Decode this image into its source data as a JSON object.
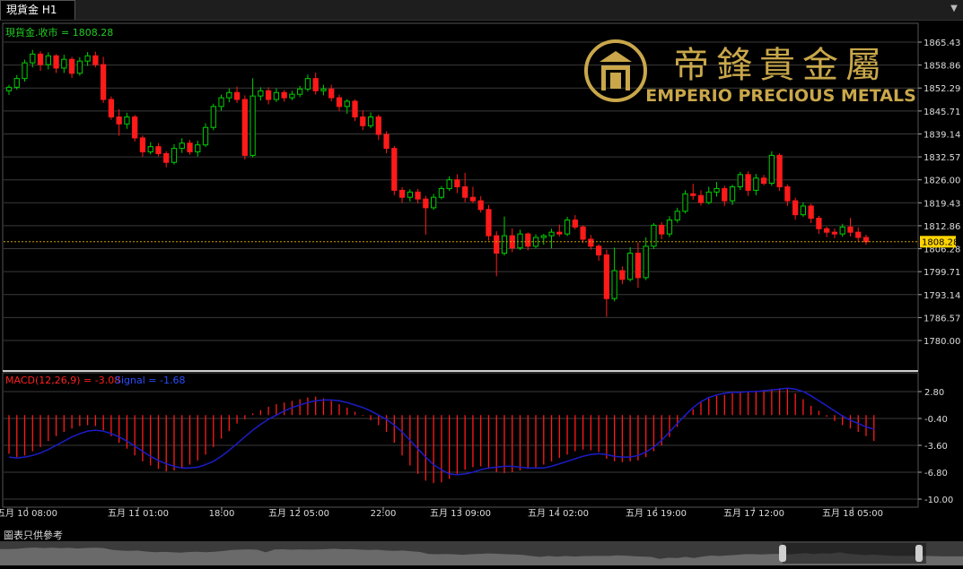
{
  "tab": {
    "title": "現貨金 H1"
  },
  "price_label": "現貨金.收市 = 1808.28",
  "current_price_tag": "1808.28",
  "logo": {
    "chinese": "帝鋒貴金屬",
    "english": "EMPERIO PRECIOUS METALS"
  },
  "macd_label": {
    "macd": "MACD(12,26,9) = -3.08",
    "signal": "Signal = -1.68"
  },
  "disclaimer": "圖表只供參考",
  "colors": {
    "up": "#00d000",
    "down": "#ff1a1a",
    "signal": "#1c1cc8",
    "grid": "#3a3a3a",
    "price_line": "#c8a200",
    "logo": "#c9a74a"
  },
  "chart_data": [
    {
      "type": "candlestick",
      "series_name": "現貨金.收市",
      "y_ticks": [
        "1865.43",
        "1858.86",
        "1852.29",
        "1845.71",
        "1839.14",
        "1832.57",
        "1826.00",
        "1819.43",
        "1812.86",
        "1806.28",
        "1799.71",
        "1793.14",
        "1786.57",
        "1780.00"
      ],
      "ylim": [
        1780.0,
        1868.0
      ],
      "x_ticks": [
        "五月 10 08:00",
        "五月 11 01:00",
        "18:00",
        "五月 12 05:00",
        "22:00",
        "五月 13 09:00",
        "五月 14 02:00",
        "五月 16 19:00",
        "五月 17 12:00",
        "五月 18 05:00"
      ],
      "last_close": 1808.28,
      "candles": [
        [
          1851.5,
          1853.2,
          1850.3,
          1852.5
        ],
        [
          1852.5,
          1856.0,
          1851.8,
          1855.0
        ],
        [
          1855.0,
          1860.4,
          1854.1,
          1859.5
        ],
        [
          1859.5,
          1863.2,
          1858.2,
          1862.0
        ],
        [
          1862.0,
          1862.8,
          1857.2,
          1859.0
        ],
        [
          1859.0,
          1862.5,
          1857.6,
          1861.5
        ],
        [
          1861.5,
          1862.0,
          1856.6,
          1858.0
        ],
        [
          1858.0,
          1861.8,
          1856.6,
          1860.5
        ],
        [
          1860.5,
          1861.2,
          1855.2,
          1856.5
        ],
        [
          1856.5,
          1861.1,
          1855.8,
          1860.0
        ],
        [
          1860.0,
          1862.6,
          1858.6,
          1861.5
        ],
        [
          1861.5,
          1862.7,
          1858.2,
          1859.0
        ],
        [
          1859.0,
          1861.2,
          1848.0,
          1849.0
        ],
        [
          1849.0,
          1849.9,
          1843.2,
          1844.0
        ],
        [
          1844.0,
          1846.2,
          1838.6,
          1842.0
        ],
        [
          1842.0,
          1845.2,
          1840.6,
          1844.0
        ],
        [
          1844.0,
          1844.6,
          1837.0,
          1838.0
        ],
        [
          1838.0,
          1838.7,
          1832.6,
          1834.0
        ],
        [
          1834.0,
          1836.8,
          1833.3,
          1835.5
        ],
        [
          1835.5,
          1836.5,
          1832.7,
          1833.5
        ],
        [
          1833.5,
          1834.2,
          1829.6,
          1831.0
        ],
        [
          1831.0,
          1836.2,
          1830.4,
          1835.0
        ],
        [
          1835.0,
          1837.9,
          1833.7,
          1836.5
        ],
        [
          1836.5,
          1837.4,
          1833.2,
          1834.0
        ],
        [
          1834.0,
          1837.2,
          1832.7,
          1836.0
        ],
        [
          1836.0,
          1842.2,
          1835.4,
          1841.0
        ],
        [
          1841.0,
          1847.8,
          1840.2,
          1847.0
        ],
        [
          1847.0,
          1850.4,
          1845.8,
          1849.5
        ],
        [
          1849.5,
          1852.2,
          1848.2,
          1851.0
        ],
        [
          1851.0,
          1852.7,
          1848.0,
          1849.0
        ],
        [
          1849.0,
          1850.2,
          1831.8,
          1833.0
        ],
        [
          1833.0,
          1855.1,
          1832.4,
          1850.0
        ],
        [
          1850.0,
          1852.5,
          1848.7,
          1851.5
        ],
        [
          1851.5,
          1852.5,
          1847.6,
          1849.0
        ],
        [
          1849.0,
          1852.2,
          1848.3,
          1851.0
        ],
        [
          1851.0,
          1851.7,
          1848.4,
          1849.5
        ],
        [
          1849.5,
          1851.5,
          1848.8,
          1850.5
        ],
        [
          1850.5,
          1852.9,
          1849.7,
          1852.0
        ],
        [
          1852.0,
          1856.1,
          1851.3,
          1855.0
        ],
        [
          1855.0,
          1856.7,
          1850.4,
          1851.5
        ],
        [
          1851.5,
          1853.2,
          1850.2,
          1852.0
        ],
        [
          1852.0,
          1853.2,
          1848.5,
          1849.5
        ],
        [
          1849.5,
          1850.4,
          1845.6,
          1847.0
        ],
        [
          1847.0,
          1849.1,
          1844.9,
          1848.5
        ],
        [
          1848.5,
          1849.0,
          1842.8,
          1844.0
        ],
        [
          1844.0,
          1845.9,
          1840.2,
          1841.5
        ],
        [
          1841.5,
          1845.3,
          1840.8,
          1844.0
        ],
        [
          1844.0,
          1844.7,
          1837.4,
          1839.0
        ],
        [
          1839.0,
          1839.9,
          1833.6,
          1835.0
        ],
        [
          1835.0,
          1835.7,
          1821.6,
          1823.0
        ],
        [
          1823.0,
          1823.9,
          1819.4,
          1821.0
        ],
        [
          1821.0,
          1823.3,
          1819.8,
          1822.5
        ],
        [
          1822.5,
          1823.4,
          1819.2,
          1820.5
        ],
        [
          1820.5,
          1821.4,
          1810.3,
          1818.0
        ],
        [
          1818.0,
          1822.0,
          1817.4,
          1821.0
        ],
        [
          1821.0,
          1824.2,
          1820.4,
          1823.5
        ],
        [
          1823.5,
          1827.0,
          1822.8,
          1826.0
        ],
        [
          1826.0,
          1827.6,
          1822.2,
          1824.0
        ],
        [
          1824.0,
          1828.0,
          1819.6,
          1821.0
        ],
        [
          1821.0,
          1824.0,
          1819.3,
          1820.0
        ],
        [
          1820.0,
          1821.3,
          1816.6,
          1817.5
        ],
        [
          1817.5,
          1818.8,
          1808.6,
          1810.0
        ],
        [
          1810.0,
          1811.3,
          1798.4,
          1805.0
        ],
        [
          1805.0,
          1815.5,
          1804.3,
          1810.0
        ],
        [
          1810.0,
          1812.1,
          1805.3,
          1806.5
        ],
        [
          1806.5,
          1811.7,
          1805.9,
          1810.5
        ],
        [
          1810.5,
          1810.9,
          1805.8,
          1807.0
        ],
        [
          1807.0,
          1810.4,
          1806.4,
          1809.5
        ],
        [
          1809.5,
          1810.5,
          1807.4,
          1810.0
        ],
        [
          1810.0,
          1812.0,
          1806.4,
          1811.0
        ],
        [
          1811.0,
          1813.2,
          1809.8,
          1810.5
        ],
        [
          1810.5,
          1815.4,
          1809.9,
          1814.5
        ],
        [
          1814.5,
          1815.9,
          1811.8,
          1812.5
        ],
        [
          1812.5,
          1813.0,
          1807.9,
          1809.0
        ],
        [
          1809.0,
          1810.2,
          1806.0,
          1807.0
        ],
        [
          1807.0,
          1807.6,
          1802.8,
          1804.5
        ],
        [
          1804.5,
          1806.0,
          1786.8,
          1792.0
        ],
        [
          1792.0,
          1806.6,
          1791.2,
          1800.0
        ],
        [
          1800.0,
          1801.2,
          1796.1,
          1797.5
        ],
        [
          1797.5,
          1806.7,
          1796.9,
          1805.0
        ],
        [
          1805.0,
          1808.1,
          1795.1,
          1798.0
        ],
        [
          1798.0,
          1809.5,
          1797.3,
          1807.0
        ],
        [
          1807.0,
          1813.6,
          1806.2,
          1813.0
        ],
        [
          1813.0,
          1813.9,
          1809.0,
          1810.5
        ],
        [
          1810.5,
          1815.6,
          1809.6,
          1814.5
        ],
        [
          1814.5,
          1818.0,
          1813.7,
          1817.0
        ],
        [
          1817.0,
          1823.0,
          1816.4,
          1822.0
        ],
        [
          1822.0,
          1824.9,
          1820.3,
          1821.5
        ],
        [
          1821.5,
          1823.0,
          1818.6,
          1819.5
        ],
        [
          1819.5,
          1824.0,
          1819.0,
          1822.5
        ],
        [
          1822.5,
          1825.4,
          1821.2,
          1823.5
        ],
        [
          1823.5,
          1824.3,
          1818.5,
          1820.0
        ],
        [
          1820.0,
          1824.6,
          1818.8,
          1824.0
        ],
        [
          1824.0,
          1828.3,
          1823.1,
          1827.5
        ],
        [
          1827.5,
          1828.4,
          1821.4,
          1823.0
        ],
        [
          1823.0,
          1827.7,
          1821.6,
          1826.5
        ],
        [
          1826.5,
          1827.4,
          1824.4,
          1825.0
        ],
        [
          1825.0,
          1834.2,
          1824.3,
          1833.0
        ],
        [
          1833.0,
          1833.6,
          1822.8,
          1824.0
        ],
        [
          1824.0,
          1824.7,
          1818.5,
          1820.0
        ],
        [
          1820.0,
          1820.9,
          1814.6,
          1816.0
        ],
        [
          1816.0,
          1819.6,
          1815.4,
          1818.5
        ],
        [
          1818.5,
          1819.2,
          1813.6,
          1815.0
        ],
        [
          1815.0,
          1815.7,
          1810.5,
          1812.0
        ],
        [
          1812.0,
          1812.6,
          1809.6,
          1811.0
        ],
        [
          1811.0,
          1812.1,
          1809.3,
          1810.5
        ],
        [
          1810.5,
          1813.4,
          1809.7,
          1812.5
        ],
        [
          1812.5,
          1815.1,
          1809.8,
          1811.0
        ],
        [
          1811.0,
          1812.4,
          1808.3,
          1809.5
        ],
        [
          1809.5,
          1810.3,
          1807.4,
          1808.28
        ]
      ]
    },
    {
      "type": "bar+line",
      "series": [
        {
          "name": "MACD(12,26,9)",
          "last": -3.08
        },
        {
          "name": "Signal",
          "last": -1.68
        }
      ],
      "y_ticks": [
        "2.80",
        "-0.40",
        "-3.60",
        "-6.80",
        "-10.00"
      ],
      "ylim": [
        -10.5,
        4.0
      ],
      "macd": [
        -4.6,
        -5.0,
        -4.8,
        -4.3,
        -3.8,
        -3.1,
        -2.5,
        -2.0,
        -1.6,
        -1.3,
        -1.2,
        -1.3,
        -1.8,
        -2.5,
        -3.3,
        -4.0,
        -4.8,
        -5.5,
        -6.0,
        -6.4,
        -6.7,
        -6.6,
        -6.3,
        -5.9,
        -5.4,
        -4.7,
        -3.8,
        -2.8,
        -1.9,
        -1.0,
        -0.5,
        0.2,
        0.6,
        1.0,
        1.3,
        1.5,
        1.7,
        1.9,
        2.1,
        2.2,
        2.0,
        1.7,
        1.3,
        0.9,
        0.4,
        -0.1,
        -0.6,
        -1.2,
        -2.0,
        -3.3,
        -4.8,
        -6.0,
        -7.0,
        -7.8,
        -8.1,
        -8.0,
        -7.6,
        -7.0,
        -6.5,
        -6.2,
        -6.1,
        -6.4,
        -6.8,
        -6.9,
        -6.8,
        -6.6,
        -6.4,
        -6.2,
        -5.9,
        -5.5,
        -5.1,
        -4.7,
        -4.3,
        -4.1,
        -4.2,
        -4.4,
        -5.2,
        -5.5,
        -5.6,
        -5.5,
        -5.4,
        -5.0,
        -4.3,
        -3.6,
        -2.6,
        -1.4,
        -0.2,
        0.7,
        1.5,
        2.0,
        2.3,
        2.4,
        2.6,
        2.8,
        2.8,
        2.9,
        3.0,
        3.1,
        3.2,
        3.1,
        2.6,
        1.9,
        1.1,
        0.5,
        -0.2,
        -0.7,
        -1.2,
        -1.6,
        -2.0,
        -2.5,
        -3.08
      ],
      "signal": [
        -5.0,
        -5.1,
        -5.0,
        -4.8,
        -4.5,
        -4.1,
        -3.6,
        -3.1,
        -2.6,
        -2.2,
        -1.9,
        -1.8,
        -1.9,
        -2.2,
        -2.6,
        -3.1,
        -3.7,
        -4.3,
        -4.9,
        -5.4,
        -5.8,
        -6.1,
        -6.3,
        -6.3,
        -6.2,
        -5.9,
        -5.5,
        -4.9,
        -4.2,
        -3.4,
        -2.6,
        -1.8,
        -1.1,
        -0.5,
        0.0,
        0.5,
        0.9,
        1.2,
        1.5,
        1.7,
        1.8,
        1.8,
        1.7,
        1.5,
        1.2,
        0.9,
        0.5,
        0.0,
        -0.5,
        -1.2,
        -2.0,
        -3.0,
        -4.0,
        -5.0,
        -5.9,
        -6.5,
        -7.0,
        -7.1,
        -7.0,
        -6.8,
        -6.5,
        -6.3,
        -6.2,
        -6.1,
        -6.1,
        -6.2,
        -6.3,
        -6.3,
        -6.3,
        -6.1,
        -5.8,
        -5.5,
        -5.2,
        -4.9,
        -4.7,
        -4.6,
        -4.7,
        -4.9,
        -5.0,
        -5.0,
        -4.8,
        -4.4,
        -3.8,
        -3.0,
        -2.0,
        -1.0,
        0.0,
        0.9,
        1.6,
        2.1,
        2.4,
        2.6,
        2.7,
        2.7,
        2.8,
        2.8,
        2.9,
        3.0,
        3.1,
        3.2,
        3.1,
        2.8,
        2.3,
        1.7,
        1.1,
        0.5,
        -0.1,
        -0.6,
        -1.0,
        -1.4,
        -1.68
      ]
    }
  ]
}
